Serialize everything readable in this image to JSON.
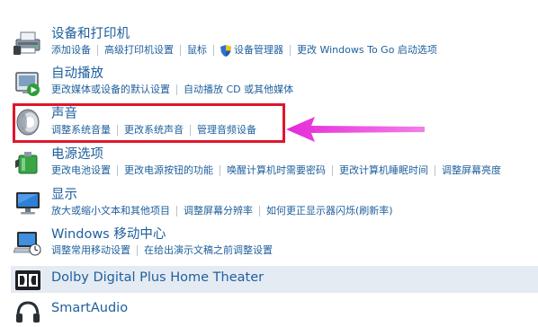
{
  "items": [
    {
      "title": "设备和打印机",
      "links": [
        "添加设备",
        "高级打印机设置",
        "鼠标",
        "设备管理器",
        "更改 Windows To Go 启动选项"
      ]
    },
    {
      "title": "自动播放",
      "links": [
        "更改媒体或设备的默认设置",
        "自动播放 CD 或其他媒体"
      ]
    },
    {
      "title": "声音",
      "links": [
        "调整系统音量",
        "更改系统声音",
        "管理音频设备"
      ]
    },
    {
      "title": "电源选项",
      "links": [
        "更改电池设置",
        "更改电源按钮的功能",
        "唤醒计算机时需要密码",
        "更改计算机睡眠时间",
        "调整屏幕亮度"
      ]
    },
    {
      "title": "显示",
      "links": [
        "放大或缩小文本和其他项目",
        "调整屏幕分辨率",
        "如何更正显示器闪烁(刷新率)"
      ]
    },
    {
      "title": "Windows 移动中心",
      "links": [
        "调整常用移动设置",
        "在给出演示文稿之前调整设置"
      ]
    },
    {
      "title": "Dolby Digital Plus Home Theater",
      "links": []
    },
    {
      "title": "SmartAudio",
      "links": []
    }
  ],
  "annotation": {
    "box_color": "#e0162b",
    "arrow_color": "#e62ad8"
  },
  "colors": {
    "link": "#1e5f9c",
    "selected_row": "#e5ebf3"
  }
}
